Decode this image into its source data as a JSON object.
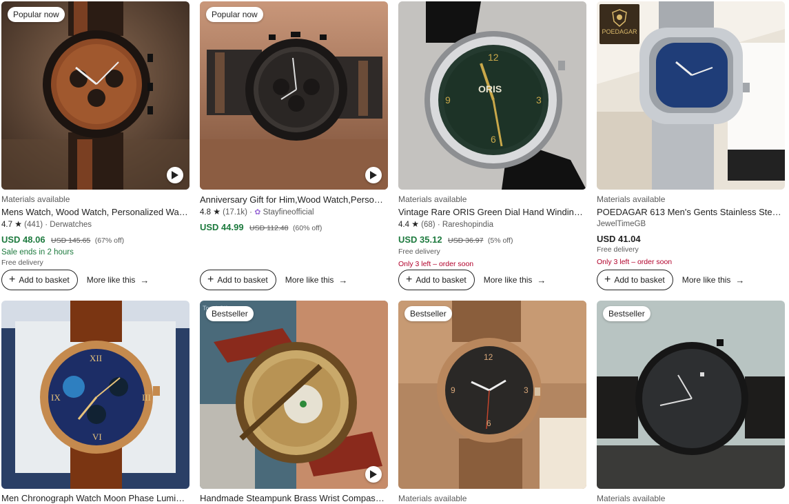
{
  "products": [
    {
      "badge": "Popular now",
      "materials": "Materials available",
      "title": "Mens Watch, Wood Watch, Personalized Watc...",
      "rating": "4.7",
      "reviews": "(441)",
      "shop": "Derwatches",
      "price": "USD 48.06",
      "original_price": "USD 145.65",
      "discount": "(67% off)",
      "sale_ends": "Sale ends in 2 hours",
      "delivery": "Free delivery",
      "add_label": "Add to basket",
      "more_label": "More like this"
    },
    {
      "badge": "Popular now",
      "materials": "",
      "title": "Anniversary Gift for Him,Wood Watch,Personal...",
      "rating": "4.8",
      "reviews": "(17.1k)",
      "shop": "Stayfineofficial",
      "price": "USD 44.99",
      "original_price": "USD 112.48",
      "discount": "(60% off)",
      "add_label": "Add to basket",
      "more_label": "More like this"
    },
    {
      "materials": "Materials available",
      "title": "Vintage Rare ORIS Green Dial Hand Winding ...",
      "rating": "4.4",
      "reviews": "(68)",
      "shop": "Rareshopindia",
      "price": "USD 35.12",
      "original_price": "USD 36.97",
      "discount": "(5% off)",
      "delivery": "Free delivery",
      "stock": "Only 3 left – order soon",
      "add_label": "Add to basket",
      "more_label": "More like this"
    },
    {
      "logo_text": "POEDAGAR",
      "materials": "Materials available",
      "title": "POEDAGAR 613 Men's Gents Stainless Steel An...",
      "shop": "JewelTimeGB",
      "price": "USD 41.04",
      "delivery": "Free delivery",
      "stock": "Only 3 left – order soon",
      "add_label": "Add to basket",
      "more_label": "More like this"
    },
    {
      "title": "Men Chronograph Watch Moon Phase Lumino..."
    },
    {
      "badge": "Bestseller",
      "title": "Handmade Steampunk Brass Wrist Compass &..."
    },
    {
      "badge": "Bestseller",
      "materials": "Materials available"
    },
    {
      "badge": "Bestseller",
      "materials": "Materials available"
    }
  ],
  "icons": {
    "star": "star-icon",
    "play": "play-icon",
    "plus": "plus-icon",
    "arrow": "arrow-right-icon",
    "shop": "shop-badge-icon"
  },
  "colors": {
    "sale_price": "#1d7a3e",
    "stock_warning": "#b1002a"
  }
}
